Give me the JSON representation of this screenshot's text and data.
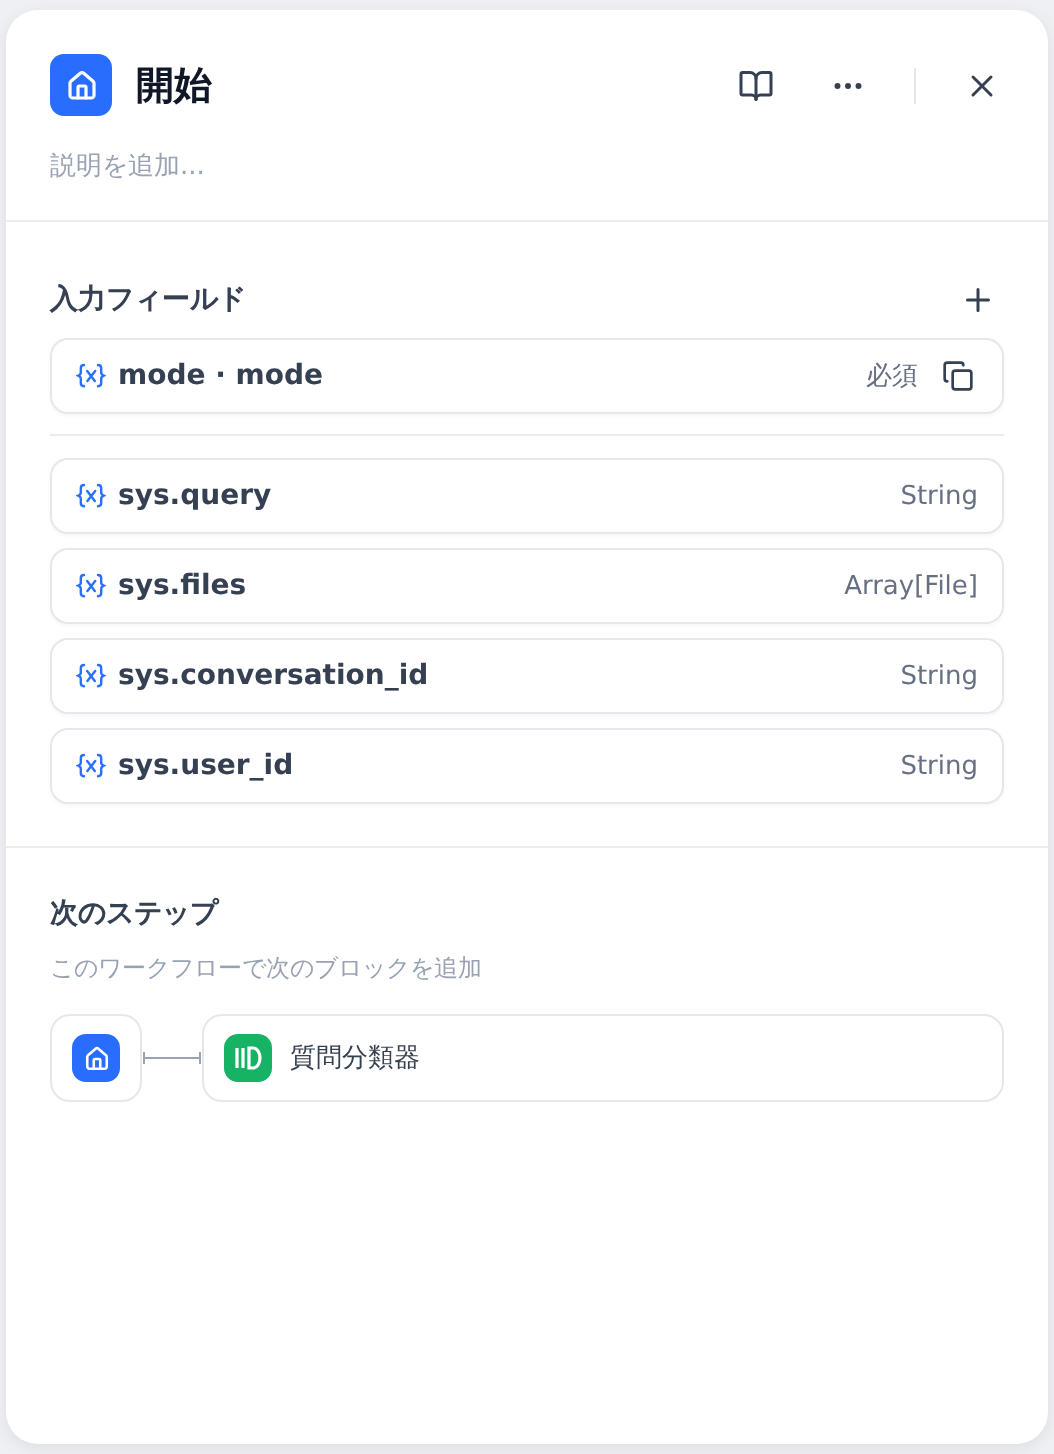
{
  "panel": {
    "title": "開始",
    "description_placeholder": "説明を追加..."
  },
  "input_section": {
    "title": "入力フィールド",
    "fields": [
      {
        "label": "mode · mode",
        "badge": "必須"
      }
    ],
    "system_fields": [
      {
        "name": "sys.query",
        "type": "String"
      },
      {
        "name": "sys.files",
        "type": "Array[File]"
      },
      {
        "name": "sys.conversation_id",
        "type": "String"
      },
      {
        "name": "sys.user_id",
        "type": "String"
      }
    ]
  },
  "next_step": {
    "title": "次のステップ",
    "subtitle": "このワークフローで次のブロックを追加",
    "blocks": [
      {
        "label": "質問分類器"
      }
    ]
  }
}
